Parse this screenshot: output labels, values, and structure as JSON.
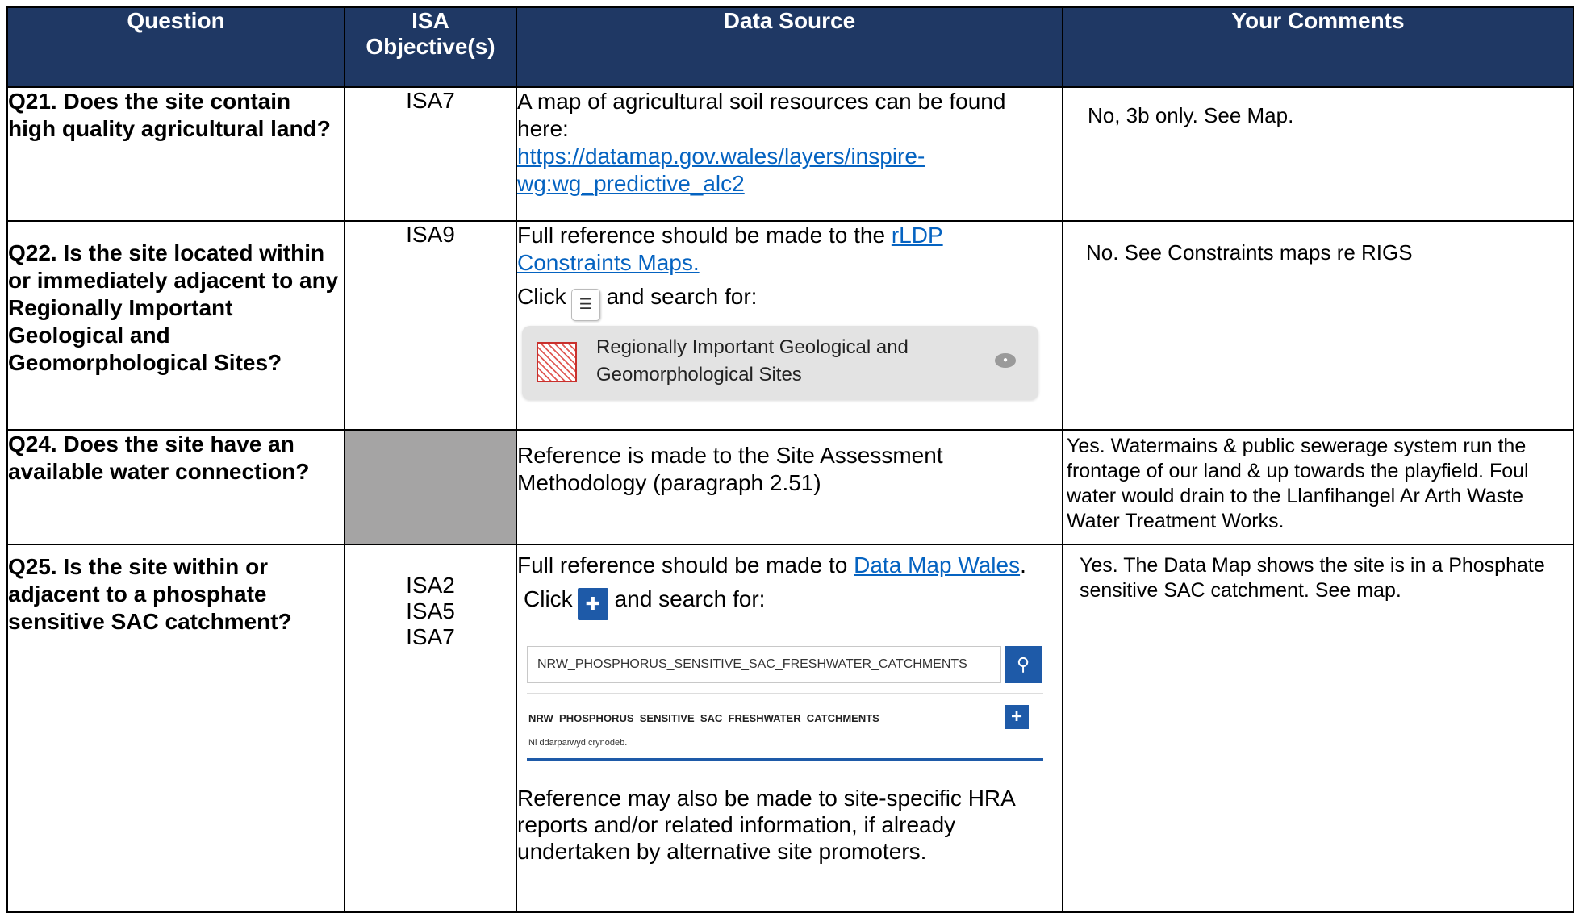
{
  "header": {
    "question": "Question",
    "isa": "ISA Objective(s)",
    "source": "Data Source",
    "comments": "Your Comments"
  },
  "rows": [
    {
      "question": "Q21. Does the site contain high quality agricultural land?",
      "isa": "ISA7",
      "source_text": "A map of agricultural soil resources can be found here:",
      "source_link": "https://datamap.gov.wales/layers/inspire-wg:wg_predictive_alc2",
      "comment": "No, 3b only. See Map."
    },
    {
      "question": "Q22. Is the site located within or immediately adjacent to any Regionally Important Geological and Geomorphological Sites?",
      "isa": "ISA9",
      "source_text": "Full reference should be made to the",
      "source_link": "rLDP Constraints Maps.",
      "click_label": "Click",
      "search_label": "and search for:",
      "layer_name": "Regionally Important Geological and Geomorphological Sites",
      "comment": "No. See Constraints maps re RIGS"
    },
    {
      "question": "Q24. Does the site have an available water connection?",
      "isa": "",
      "source_text": "Reference is made to the Site Assessment Methodology (paragraph 2.51)",
      "comment": "Yes. Watermains & public sewerage system run the frontage of our land & up towards the playfield. Foul water would drain to the Llanfihangel Ar Arth Waste Water Treatment Works."
    },
    {
      "question": "Q25. Is the site within or adjacent to a phosphate sensitive SAC catchment?",
      "isa_lines": [
        "ISA2",
        "ISA5",
        "ISA7"
      ],
      "source_text": "Full reference should be made to",
      "source_link": "Data Map Wales",
      "source_after": ".",
      "click_label": "Click",
      "search_label": "and search for:",
      "search_value": "NRW_PHOSPHORUS_SENSITIVE_SAC_FRESHWATER_CATCHMENTS",
      "result_title": "NRW_PHOSPHORUS_SENSITIVE_SAC_FRESHWATER_CATCHMENTS",
      "result_sub": "Ni ddarparwyd crynodeb.",
      "source_extra": "Reference may also be made to site-specific HRA reports and/or related information, if already undertaken by alternative site promoters.",
      "comment": "Yes.  The Data Map shows the site is in a Phosphate sensitive SAC catchment. See map."
    }
  ],
  "colors": {
    "header_bg": "#1f3864",
    "gray_cell": "#a5a4a4",
    "link": "#0563c1",
    "button_blue": "#1e5aa8"
  }
}
